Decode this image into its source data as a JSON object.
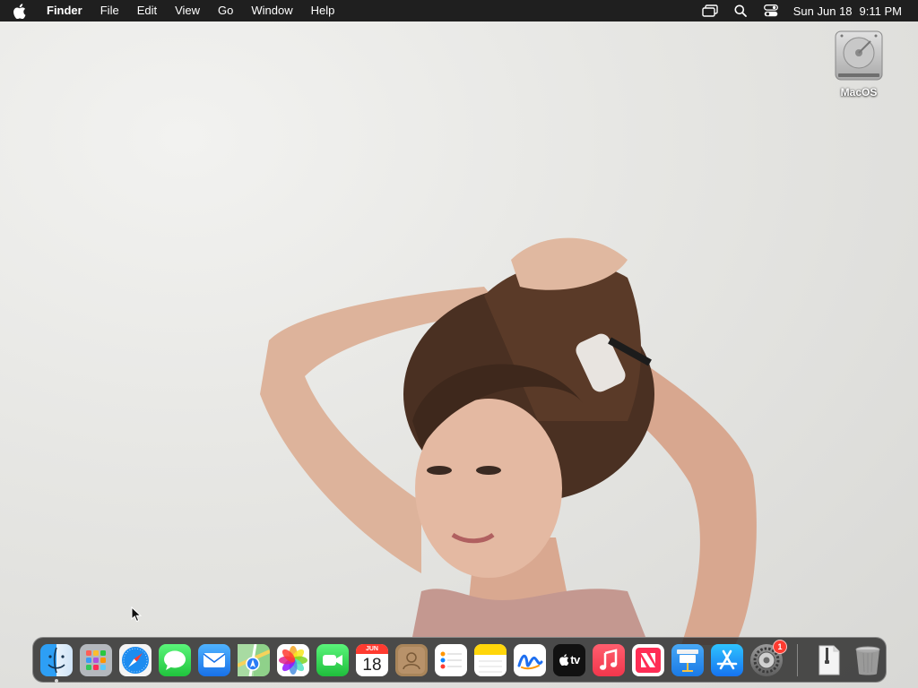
{
  "menubar": {
    "apple_icon": "apple-logo-icon",
    "app_name": "Finder",
    "items": [
      "File",
      "Edit",
      "View",
      "Go",
      "Window",
      "Help"
    ],
    "status_icons": [
      "screen-mirroring-icon",
      "spotlight-search-icon",
      "control-center-icon"
    ],
    "date": "Sun Jun 18",
    "time": "9:11 PM"
  },
  "desktop": {
    "drive_label": "MacOS",
    "drive_icon": "hard-drive-icon"
  },
  "dock": {
    "items": [
      {
        "name": "Finder",
        "icon": "finder-icon",
        "running": true
      },
      {
        "name": "Launchpad",
        "icon": "launchpad-icon"
      },
      {
        "name": "Safari",
        "icon": "safari-icon"
      },
      {
        "name": "Messages",
        "icon": "messages-icon"
      },
      {
        "name": "Mail",
        "icon": "mail-icon"
      },
      {
        "name": "Maps",
        "icon": "maps-icon"
      },
      {
        "name": "Photos",
        "icon": "photos-icon"
      },
      {
        "name": "FaceTime",
        "icon": "facetime-icon"
      },
      {
        "name": "Calendar",
        "icon": "calendar-icon",
        "month": "JUN",
        "day": "18"
      },
      {
        "name": "Contacts",
        "icon": "contacts-icon"
      },
      {
        "name": "Reminders",
        "icon": "reminders-icon"
      },
      {
        "name": "Notes",
        "icon": "notes-icon"
      },
      {
        "name": "Freeform",
        "icon": "freeform-icon"
      },
      {
        "name": "TV",
        "icon": "apple-tv-icon",
        "label": "tv"
      },
      {
        "name": "Music",
        "icon": "music-icon"
      },
      {
        "name": "News",
        "icon": "news-icon"
      },
      {
        "name": "Keynote",
        "icon": "keynote-icon"
      },
      {
        "name": "App Store",
        "icon": "app-store-icon"
      },
      {
        "name": "System Settings",
        "icon": "system-settings-icon",
        "badge": "1"
      },
      {
        "name": "Archive",
        "icon": "zip-archive-icon"
      },
      {
        "name": "Trash",
        "icon": "trash-icon"
      }
    ]
  },
  "colors": {
    "menubar_bg": "#1f1f1f",
    "badge": "#ff3b30",
    "wallpaper": "#e6e6e3"
  }
}
